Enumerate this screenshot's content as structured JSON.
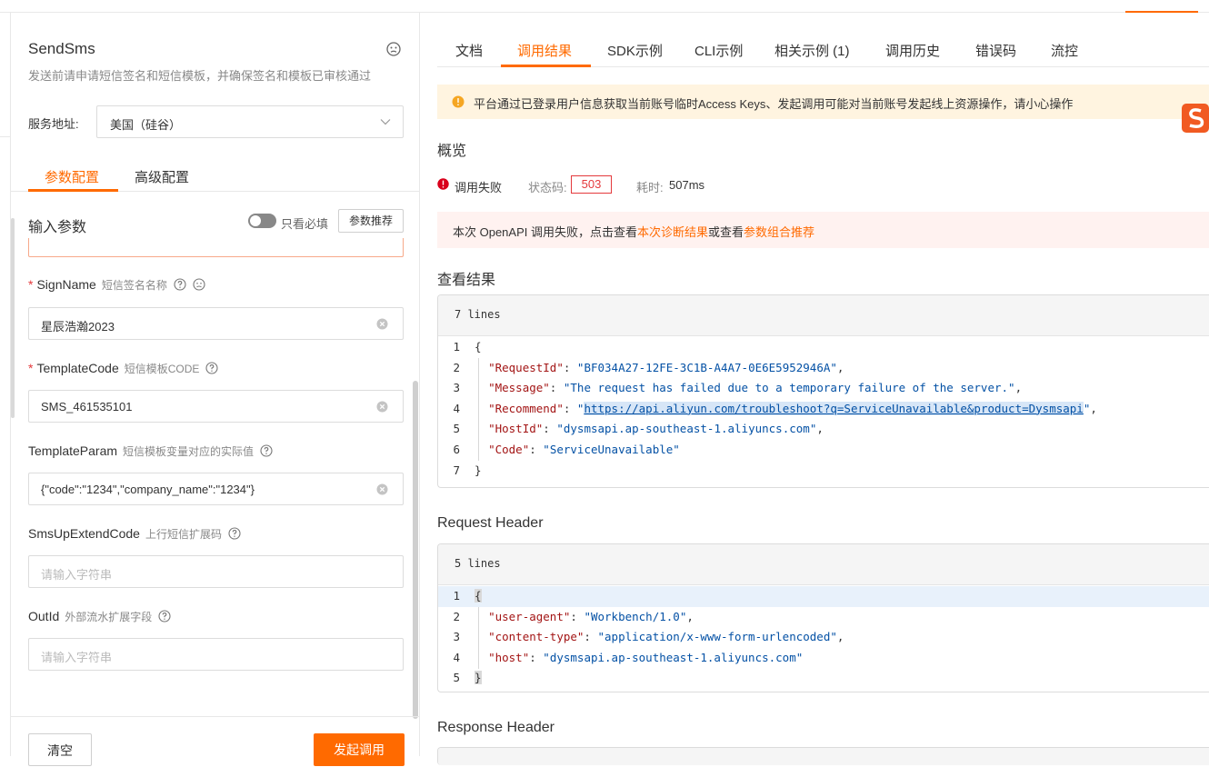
{
  "api": {
    "name": "SendSms",
    "description": "发送前请申请短信签名和短信模板，并确保签名和模板已审核通过"
  },
  "service": {
    "label": "服务地址:",
    "value": "美国（硅谷）"
  },
  "left_tabs": [
    "参数配置",
    "高级配置"
  ],
  "input_params": {
    "title": "输入参数",
    "required_only_label": "只看必填",
    "recommend_button": "参数推荐"
  },
  "fields": [
    {
      "name": "SignName",
      "desc": "短信签名名称",
      "required": true,
      "value": "星辰浩瀚2023",
      "placeholder": ""
    },
    {
      "name": "TemplateCode",
      "desc": "短信模板CODE",
      "required": true,
      "value": "SMS_461535101",
      "placeholder": ""
    },
    {
      "name": "TemplateParam",
      "desc": "短信模板变量对应的实际值",
      "required": false,
      "value": "{\"code\":\"1234\",\"company_name\":\"1234\"}",
      "placeholder": ""
    },
    {
      "name": "SmsUpExtendCode",
      "desc": "上行短信扩展码",
      "required": false,
      "value": "",
      "placeholder": "请输入字符串"
    },
    {
      "name": "OutId",
      "desc": "外部流水扩展字段",
      "required": false,
      "value": "",
      "placeholder": "请输入字符串"
    }
  ],
  "actions": {
    "clear": "清空",
    "invoke": "发起调用"
  },
  "right_tabs": [
    "文档",
    "调用结果",
    "SDK示例",
    "CLI示例",
    "相关示例 (1)",
    "调用历史",
    "错误码",
    "流控"
  ],
  "warning": "平台通过已登录用户信息获取当前账号临时Access Keys、发起调用可能对当前账号发起线上资源操作，请小心操作",
  "overview": {
    "title": "概览",
    "status_text": "调用失败",
    "status_code_label": "状态码:",
    "status_code": "503",
    "elapsed_label": "耗时:",
    "elapsed": "507ms"
  },
  "diagnosis": {
    "prefix": "本次 OpenAPI 调用失败，点击查看",
    "link1": "本次诊断结果",
    "middle": "或查看",
    "link2": "参数组合推荐"
  },
  "result": {
    "title": "查看结果",
    "lines_label": "7 lines",
    "json": {
      "RequestId": "BF034A27-12FE-3C1B-A4A7-0E6E5952946A",
      "Message": "The request has failed due to a temporary failure of the server.",
      "Recommend": "https://api.aliyun.com/troubleshoot?q=ServiceUnavailable&product=Dysmsapi",
      "HostId": "dysmsapi.ap-southeast-1.aliyuncs.com",
      "Code": "ServiceUnavailable"
    }
  },
  "request_header": {
    "title": "Request Header",
    "lines_label": "5 lines",
    "json": {
      "user-agent": "Workbench/1.0",
      "content-type": "application/x-www-form-urlencoded",
      "host": "dysmsapi.ap-southeast-1.aliyuncs.com"
    }
  },
  "response_header": {
    "title": "Response Header"
  },
  "icons": {
    "feedback": "face-neutral-icon",
    "help": "question-circle-icon",
    "clear": "clear-circle-icon",
    "warning": "warning-circle-icon",
    "error": "error-circle-icon",
    "chevron": "chevron-down-icon"
  },
  "colors": {
    "accent": "#ff6a00",
    "error": "#e4393c",
    "warning_bg": "#fff4e0",
    "error_bg": "#fff2f0"
  }
}
